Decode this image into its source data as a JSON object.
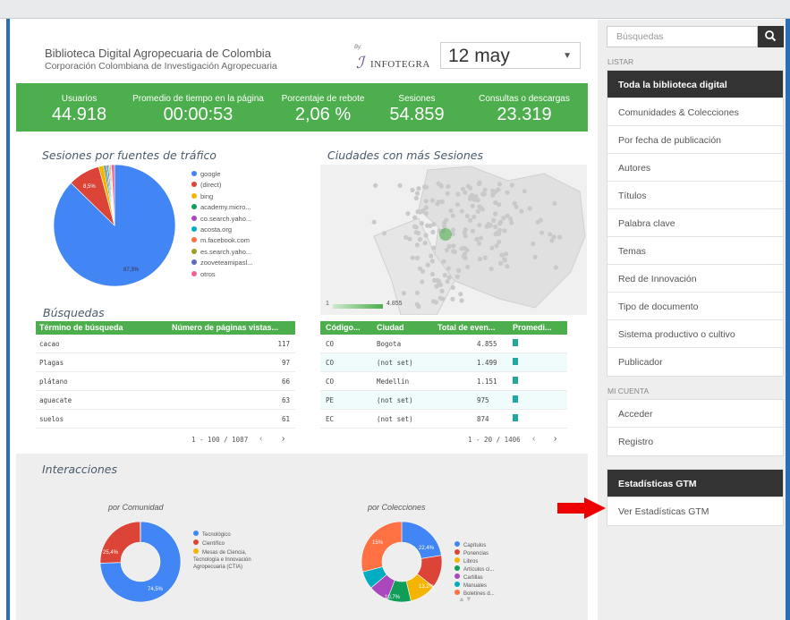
{
  "header": {
    "title": "Biblioteca Digital Agropecuaria de Colombia",
    "subtitle": "Corporación Colombiana de Investigación Agropecuaria",
    "logo_by": "By:",
    "logo_text": "INFOTEGRA",
    "date": "12 may"
  },
  "kpis": [
    {
      "label": "Usuarios",
      "value": "44.918"
    },
    {
      "label": "Promedio de tiempo en la página",
      "value": "00:00:53"
    },
    {
      "label": "Porcentaje de rebote",
      "value": "2,06 %"
    },
    {
      "label": "Sesiones",
      "value": "54.859"
    },
    {
      "label": "Consultas o descargas",
      "value": "23.319"
    }
  ],
  "traffic": {
    "title": "Sesiones por fuentes de tráfico",
    "chart_data": {
      "type": "pie",
      "labels": [
        "google",
        "(direct)",
        "bing",
        "academy.micro...",
        "co.search.yaho...",
        "acosta.org",
        "m.facebook.com",
        "es.search.yaho...",
        "zooveteamipasl...",
        "otros"
      ],
      "values": [
        87.3,
        8.5,
        1.3,
        0.5,
        0.4,
        0.4,
        0.3,
        0.3,
        0.2,
        0.8
      ],
      "data_labels": [
        "87,3%",
        "8,5%"
      ],
      "colors": [
        "#4285f4",
        "#db4437",
        "#f4b400",
        "#0f9d58",
        "#ab47bc",
        "#00acc1",
        "#ff7043",
        "#9e9d24",
        "#5c6bc0",
        "#f06292"
      ]
    }
  },
  "cities": {
    "title": "Ciudades con más Sesiones",
    "scale_min": "1",
    "scale_max": "4.855"
  },
  "searches": {
    "title": "Búsquedas",
    "col1": "Término de búsqueda",
    "col2": "Número de páginas vistas...",
    "rows": [
      {
        "term": "cacao",
        "views": "117"
      },
      {
        "term": "Plagas",
        "views": "97"
      },
      {
        "term": "plátano",
        "views": "66"
      },
      {
        "term": "aguacate",
        "views": "63"
      },
      {
        "term": "suelos",
        "views": "61"
      }
    ],
    "pagination": "1 - 100 / 1087"
  },
  "cities_table": {
    "col1": "Código...",
    "col2": "Ciudad",
    "col3": "Total de even...",
    "col4": "Promedi...",
    "rows": [
      {
        "code": "CO",
        "city": "Bogota",
        "total": "4.855",
        "bar": 1.0
      },
      {
        "code": "CO",
        "city": "(not set)",
        "total": "1.499",
        "bar": 1.0
      },
      {
        "code": "CO",
        "city": "Medellin",
        "total": "1.151",
        "bar": 1.0
      },
      {
        "code": "PE",
        "city": "(not set)",
        "total": "975",
        "bar": 1.0
      },
      {
        "code": "EC",
        "city": "(not set)",
        "total": "874",
        "bar": 1.0
      }
    ],
    "pagination": "1 - 20 / 1406"
  },
  "interactions": {
    "title": "Interacciones",
    "chart_data": [
      {
        "type": "pie",
        "title": "por Comunidad",
        "labels": [
          "Tecnológico",
          "Científico",
          "Mesas de Ciencia, Tecnología e Innovación Agropecuaria (CTIA)"
        ],
        "values": [
          74.5,
          25.4,
          0.1
        ],
        "data_labels": [
          "74,5%",
          "25,4%"
        ],
        "colors": [
          "#4285f4",
          "#db4437",
          "#f4b400"
        ]
      },
      {
        "type": "pie",
        "title": "por Colecciones",
        "labels": [
          "Capítulos",
          "Ponencias",
          "Libros",
          "Artículos ci...",
          "Cartillas",
          "Manuales",
          "Boletines d..."
        ],
        "values": [
          22.4,
          13.2,
          10.7,
          9.5,
          8.0,
          7.2,
          29.0
        ],
        "data_labels": [
          "22,4%",
          "13,2%",
          "10,7%",
          "15%"
        ],
        "colors": [
          "#4285f4",
          "#db4437",
          "#f4b400",
          "#0f9d58",
          "#ab47bc",
          "#00acc1",
          "#ff7043",
          "#f06292",
          "#9e9d24",
          "#5c6bc0"
        ]
      }
    ]
  },
  "sidebar": {
    "search_placeholder": "Búsquedas",
    "listar_label": "LISTAR",
    "listar": [
      "Toda la biblioteca digital",
      "Comunidades & Colecciones",
      "Por fecha de publicación",
      "Autores",
      "Títulos",
      "Palabra clave",
      "Temas",
      "Red de Innovación",
      "Tipo de documento",
      "Sistema productivo o cultivo",
      "Publicador"
    ],
    "cuenta_label": "MI CUENTA",
    "cuenta": [
      "Acceder",
      "Registro"
    ],
    "stats_header": "Estadísticas GTM",
    "stats_link": "Ver Estadísticas GTM"
  }
}
